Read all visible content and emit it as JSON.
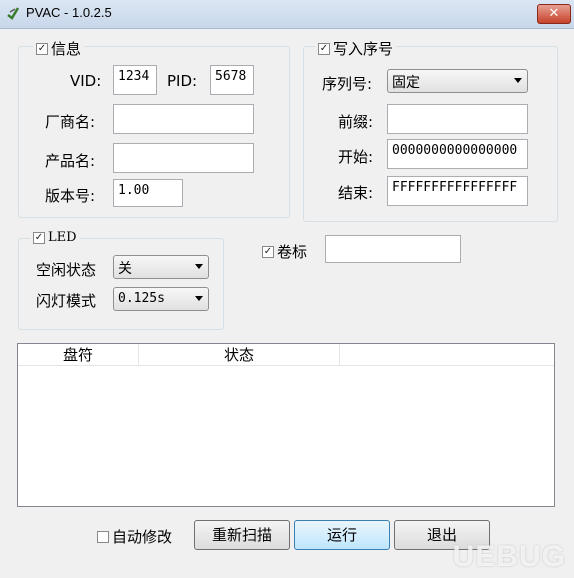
{
  "window": {
    "title": "PVAC - 1.0.2.5",
    "close_label": "✕"
  },
  "info": {
    "legend": "信息",
    "vid_label": "VID:",
    "vid_value": "1234",
    "pid_label": "PID:",
    "pid_value": "5678",
    "vendor_label": "厂商名:",
    "vendor_value": "",
    "product_label": "产品名:",
    "product_value": "",
    "version_label": "版本号:",
    "version_value": "1.00"
  },
  "serial": {
    "legend": "写入序号",
    "seq_label": "序列号:",
    "seq_value": "固定",
    "prefix_label": "前缀:",
    "prefix_value": "",
    "start_label": "开始:",
    "start_value": "0000000000000000",
    "end_label": "结束:",
    "end_value": "FFFFFFFFFFFFFFFF"
  },
  "led": {
    "legend": "LED",
    "idle_label": "空闲状态",
    "idle_value": "关",
    "blink_label": "闪灯模式",
    "blink_value": "0.125s"
  },
  "volume": {
    "label": "卷标",
    "value": ""
  },
  "table": {
    "columns": [
      "盘符",
      "状态"
    ]
  },
  "footer": {
    "auto_fix_label": "自动修改",
    "rescan_label": "重新扫描",
    "run_label": "运行",
    "exit_label": "退出"
  },
  "watermark": "UEBUG"
}
